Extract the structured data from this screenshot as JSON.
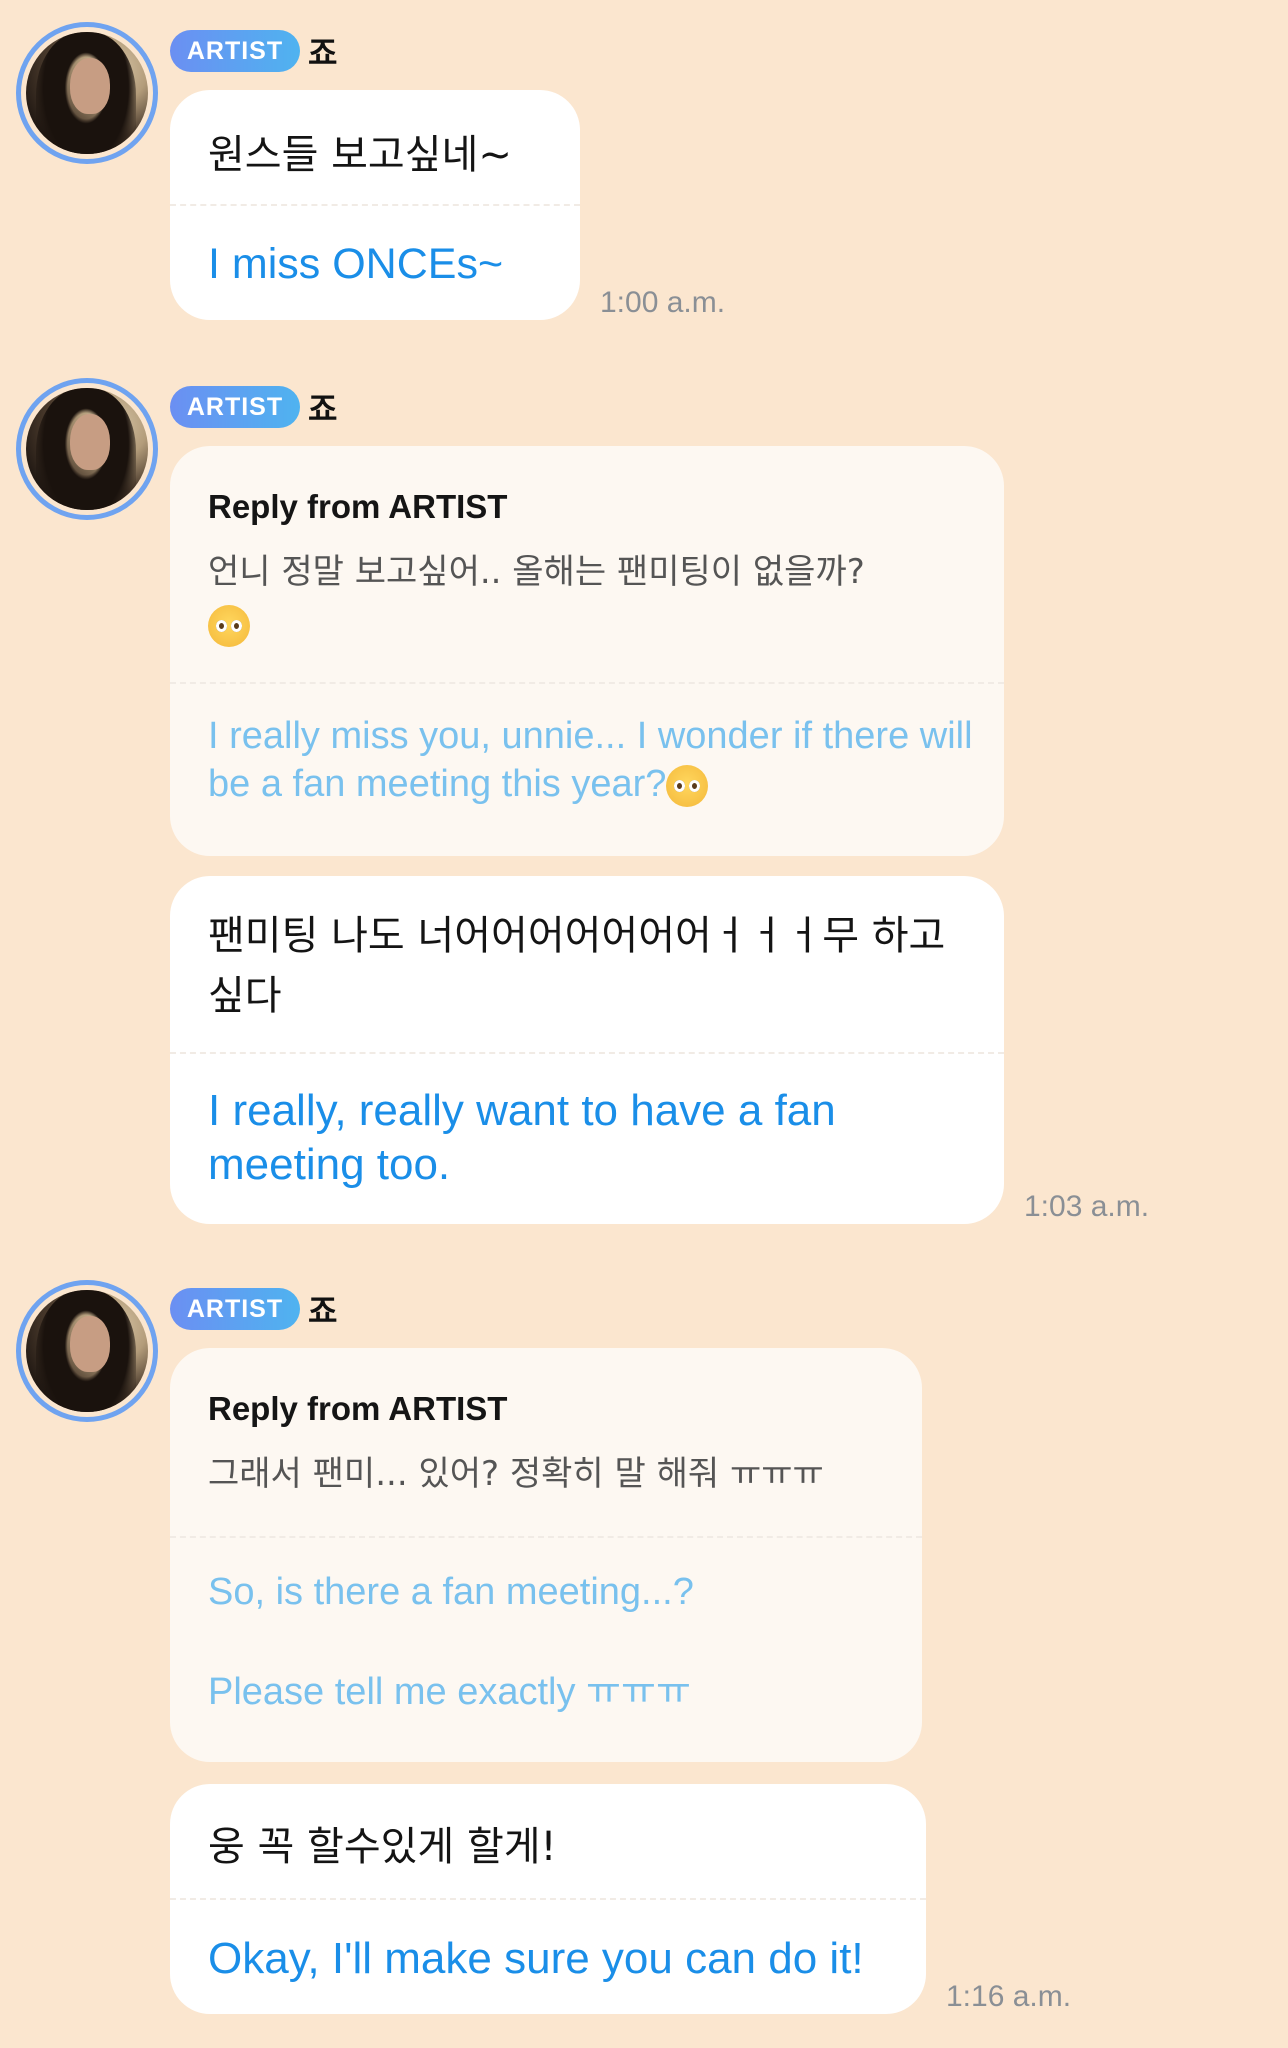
{
  "sender": {
    "badge": "ARTIST",
    "name": "죠"
  },
  "messages": [
    {
      "ko": "원스들 보고싶네~",
      "en": "I miss ONCEs~",
      "time": "1:00 a.m."
    },
    {
      "reply": {
        "header": "Reply from ARTIST",
        "ko": "언니 정말 보고싶어.. 올해는 팬미팅이 없을까?",
        "en": "I really miss you, unnie... I wonder if there will be a fan meeting this year?",
        "emoji": "pleading-face-emoji"
      },
      "ko": "팬미팅 나도 너어어어어어어어ㅓㅓㅓ무 하고싶다",
      "en": "I really, really want to have a fan meeting too.",
      "time": "1:03 a.m."
    },
    {
      "reply": {
        "header": "Reply from ARTIST",
        "ko": "그래서 팬미... 있어? 정확히 말 해줘 ㅠㅠㅠ",
        "en_line1": "So, is there a fan meeting...?",
        "en_line2": "Please tell me exactly ㅠㅠㅠ"
      },
      "ko": "웅 꼭 할수있게 할게!",
      "en": "Okay, I'll make sure you can do it!",
      "time": "1:16 a.m."
    }
  ]
}
